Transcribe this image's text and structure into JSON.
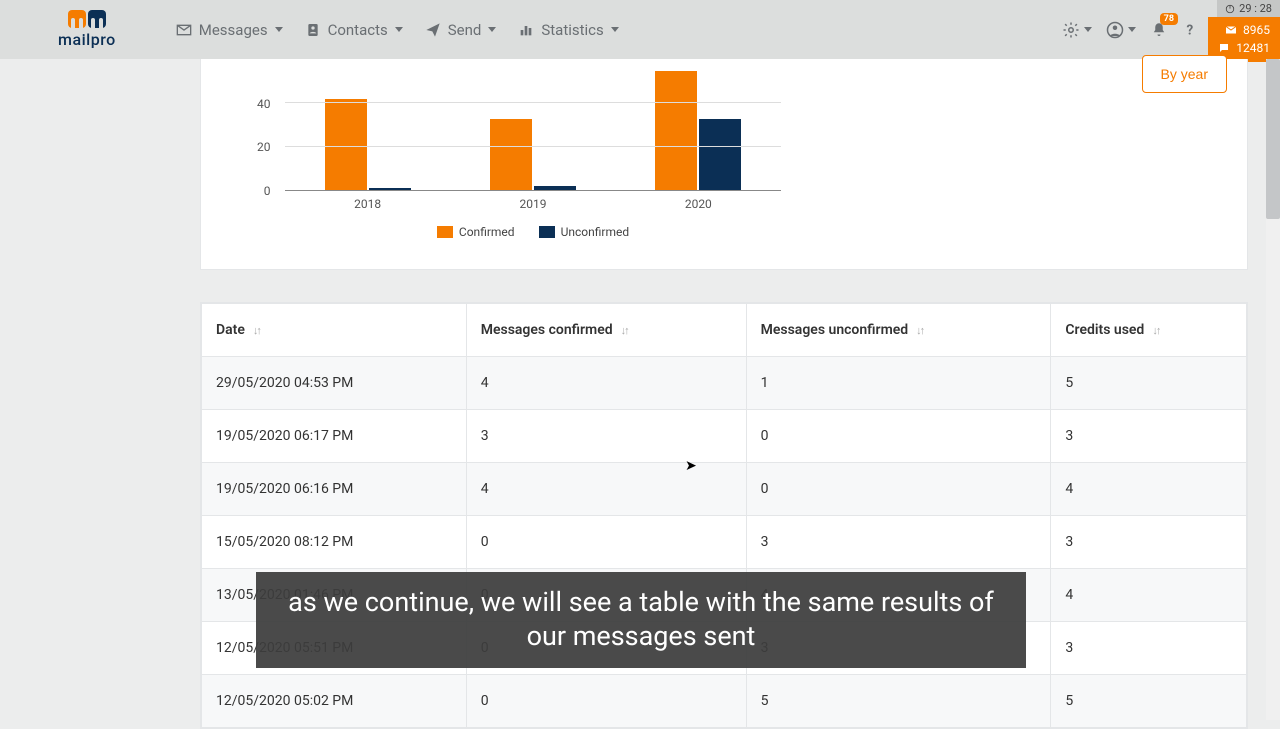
{
  "brand": {
    "name": "mailpro"
  },
  "nav": {
    "messages": "Messages",
    "contacts": "Contacts",
    "send": "Send",
    "statistics": "Statistics"
  },
  "header": {
    "timer": "29 : 28",
    "credits_mail": "8965",
    "credits_sms": "12481",
    "bell_badge": "78"
  },
  "chart_data": {
    "type": "bar",
    "categories": [
      "2018",
      "2019",
      "2020"
    ],
    "series": [
      {
        "name": "Confirmed",
        "values": [
          42,
          33,
          55
        ],
        "color": "#f57c00"
      },
      {
        "name": "Unconfirmed",
        "values": [
          1,
          2,
          33
        ],
        "color": "#0b2f55"
      }
    ],
    "y_ticks": [
      0,
      20,
      40
    ],
    "ylim": [
      0,
      55
    ],
    "xlabel": "",
    "ylabel": ""
  },
  "buttons": {
    "by_year": "By year"
  },
  "table": {
    "headers": {
      "date": "Date",
      "confirmed": "Messages confirmed",
      "unconfirmed": "Messages unconfirmed",
      "credits": "Credits used"
    },
    "rows": [
      {
        "date": "29/05/2020 04:53 PM",
        "confirmed": "4",
        "unconfirmed": "1",
        "credits": "5"
      },
      {
        "date": "19/05/2020 06:17 PM",
        "confirmed": "3",
        "unconfirmed": "0",
        "credits": "3"
      },
      {
        "date": "19/05/2020 06:16 PM",
        "confirmed": "4",
        "unconfirmed": "0",
        "credits": "4"
      },
      {
        "date": "15/05/2020 08:12 PM",
        "confirmed": "0",
        "unconfirmed": "3",
        "credits": "3"
      },
      {
        "date": "13/05/2020 01:46 PM",
        "confirmed": "0",
        "unconfirmed": "4",
        "credits": "4"
      },
      {
        "date": "12/05/2020 05:51 PM",
        "confirmed": "0",
        "unconfirmed": "3",
        "credits": "3"
      },
      {
        "date": "12/05/2020 05:02 PM",
        "confirmed": "0",
        "unconfirmed": "5",
        "credits": "5"
      }
    ]
  },
  "caption": "as we continue, we will see a table with the same results of our messages sent"
}
